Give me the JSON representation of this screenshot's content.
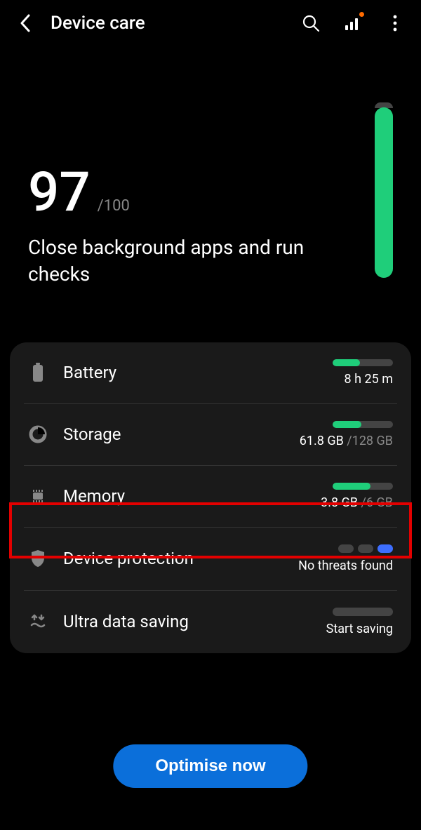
{
  "header": {
    "title": "Device care"
  },
  "score": {
    "value": "97",
    "max": "/100",
    "description": "Close background apps and run checks",
    "fill_percent": 97
  },
  "rows": {
    "battery": {
      "label": "Battery",
      "sub": "8 h 25 m",
      "fill": 45
    },
    "storage": {
      "label": "Storage",
      "used": "61.8 GB",
      "total": " /128 GB",
      "fill": 48
    },
    "memory": {
      "label": "Memory",
      "used": "3.8 GB",
      "total": " /6 GB",
      "fill": 63
    },
    "protection": {
      "label": "Device protection",
      "sub": "No threats found"
    },
    "datasaving": {
      "label": "Ultra data saving",
      "sub": "Start saving"
    }
  },
  "button": {
    "optimise": "Optimise now"
  }
}
